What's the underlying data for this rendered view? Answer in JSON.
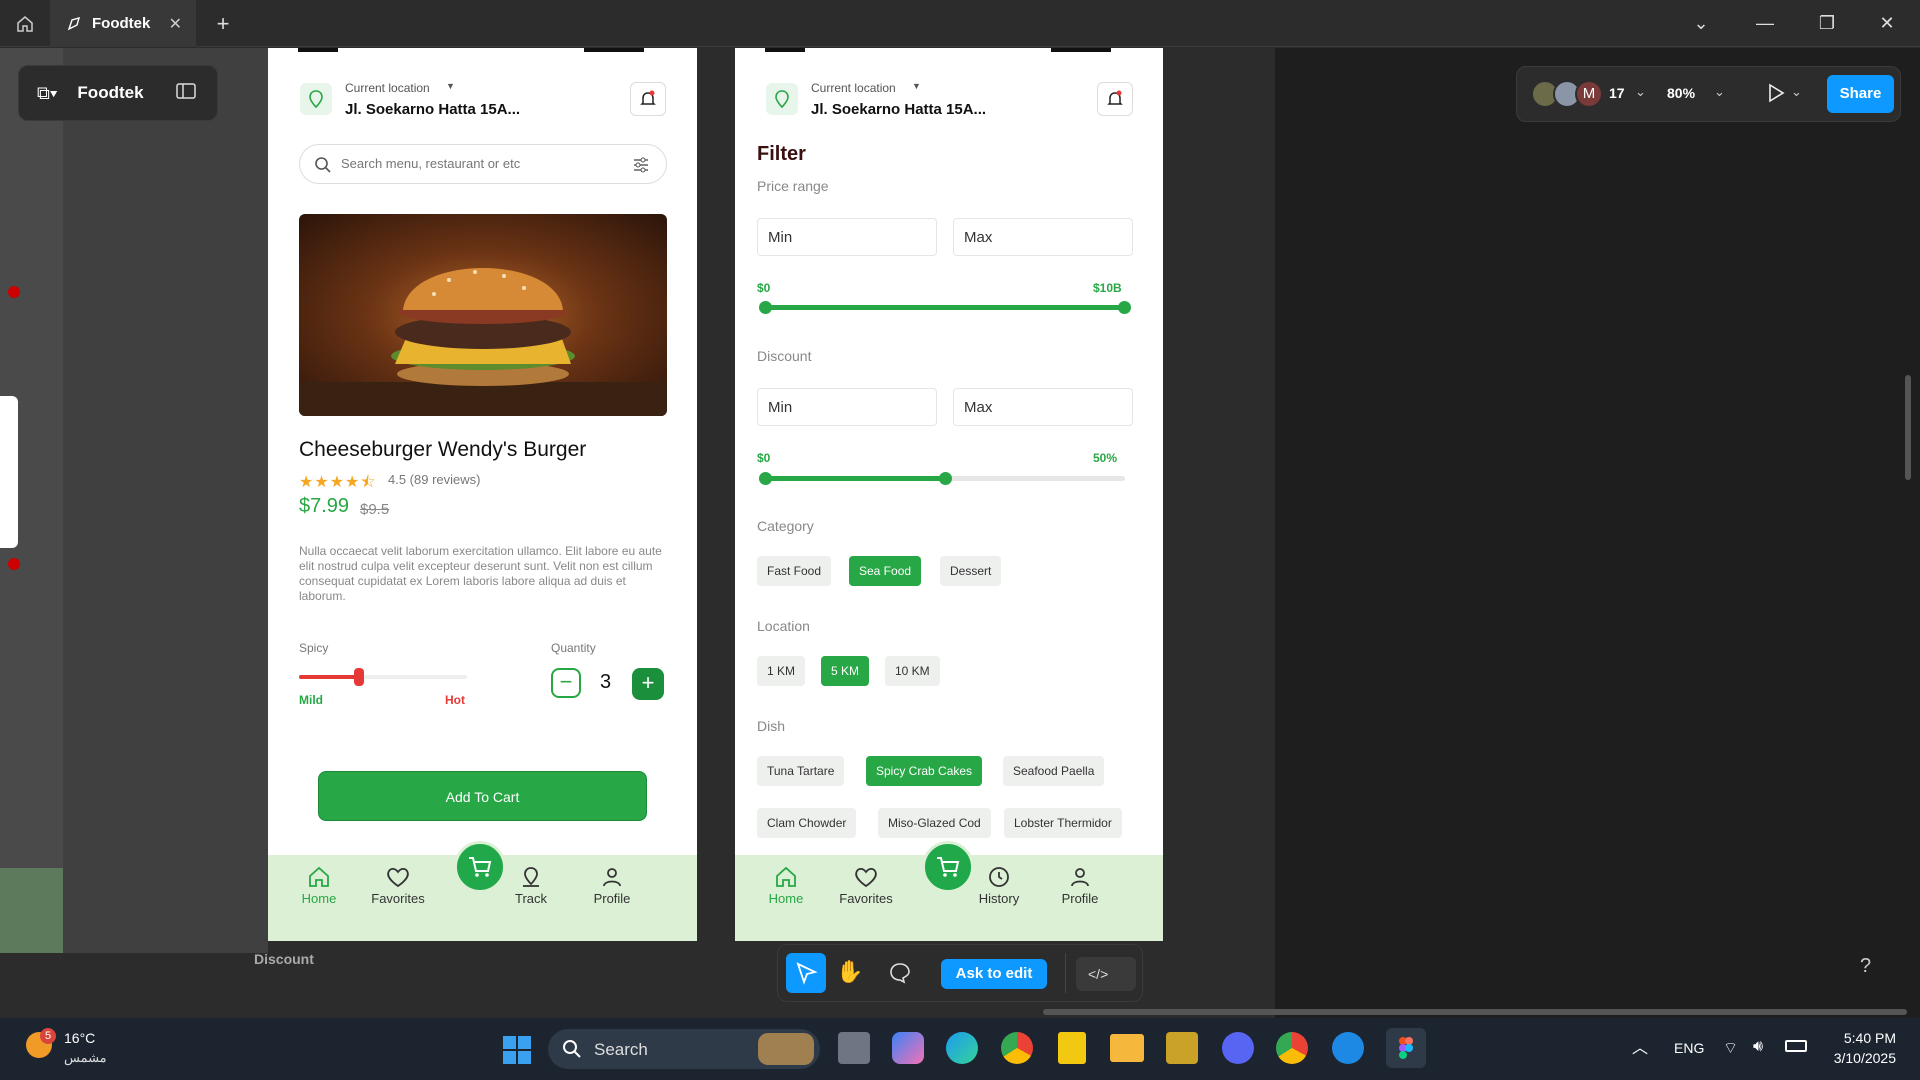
{
  "window": {
    "tab_title": "Foodtek",
    "home_icon": "home-icon",
    "close_icon": "close-icon",
    "new_tab_icon": "plus-icon"
  },
  "figma": {
    "file_name": "Foodtek",
    "collaborator_initial": "M",
    "collaborator_count": "17",
    "zoom": "80%",
    "share_label": "Share",
    "ask_to_edit": "Ask to edit",
    "help": "?",
    "canvas_label": "Discount"
  },
  "screen_left": {
    "location_label": "Current location",
    "address": "Jl. Soekarno Hatta 15A...",
    "search_placeholder": "Search menu, restaurant or etc",
    "product_title": "Cheeseburger Wendy's Burger",
    "rating_text": "4.5 (89 reviews)",
    "rating_value": 4.5,
    "price": "$7.99",
    "old_price": "$9.5",
    "description": "Nulla occaecat velit laborum exercitation ullamco. Elit labore eu aute elit nostrud culpa velit excepteur deserunt sunt. Velit non est cillum consequat cupidatat ex Lorem laboris labore aliqua ad duis et laborum.",
    "spicy_label": "Spicy",
    "spicy_min": "Mild",
    "spicy_max": "Hot",
    "spicy_level": 0.36,
    "quantity_label": "Quantity",
    "quantity": "3",
    "add_to_cart": "Add To Cart",
    "nav": [
      "Home",
      "Favorites",
      "Track",
      "Profile"
    ]
  },
  "screen_right": {
    "location_label": "Current location",
    "address": "Jl. Soekarno Hatta 15A...",
    "filter_title": "Filter",
    "price_range_label": "Price range",
    "price_min": "Min",
    "price_max": "Max",
    "price_low": "$0",
    "price_high": "$10B",
    "discount_label": "Discount",
    "discount_min": "Min",
    "discount_max": "Max",
    "discount_low": "$0",
    "discount_high": "50%",
    "discount_level": 0.5,
    "category_label": "Category",
    "categories": [
      "Fast Food",
      "Sea Food",
      "Dessert"
    ],
    "location_section": "Location",
    "distances": [
      "1 KM",
      "5 KM",
      "10 KM"
    ],
    "dish_label": "Dish",
    "dishes": [
      "Tuna Tartare",
      "Spicy Crab Cakes",
      "Seafood Paella",
      "Clam Chowder",
      "Miso-Glazed Cod",
      "Lobster Thermidor"
    ],
    "nav": [
      "Home",
      "Favorites",
      "History",
      "Profile"
    ]
  },
  "taskbar": {
    "weather_temp": "16°C",
    "weather_desc": "مشمس",
    "weather_badge": "5",
    "search_label": "Search",
    "lang": "ENG",
    "time": "5:40 PM",
    "date": "3/10/2025"
  },
  "colors": {
    "accent_green": "#27a745",
    "figma_blue": "#0d99ff"
  }
}
